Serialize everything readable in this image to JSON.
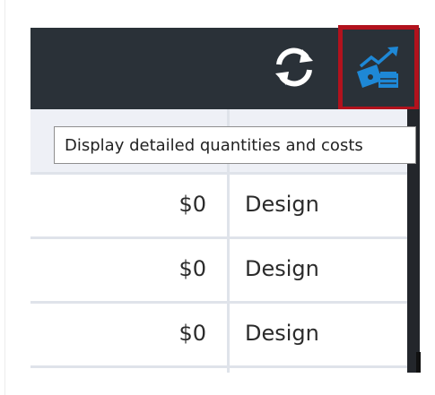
{
  "toolbar": {
    "refresh_button": {
      "icon": "refresh-icon"
    },
    "cost_button": {
      "icon": "cost-chart-icon",
      "highlight_color": "#b2121d"
    }
  },
  "tooltip": {
    "text": "Display detailed quantities and costs"
  },
  "table": {
    "rows": [
      {
        "cost": "$0",
        "phase": "Design"
      },
      {
        "cost": "$0",
        "phase": "Design"
      },
      {
        "cost": "$0",
        "phase": "Design"
      }
    ]
  },
  "colors": {
    "toolbar_bg": "#2a3138",
    "header_bg": "#eef0f6",
    "icon_blue": "#1e88d6"
  }
}
